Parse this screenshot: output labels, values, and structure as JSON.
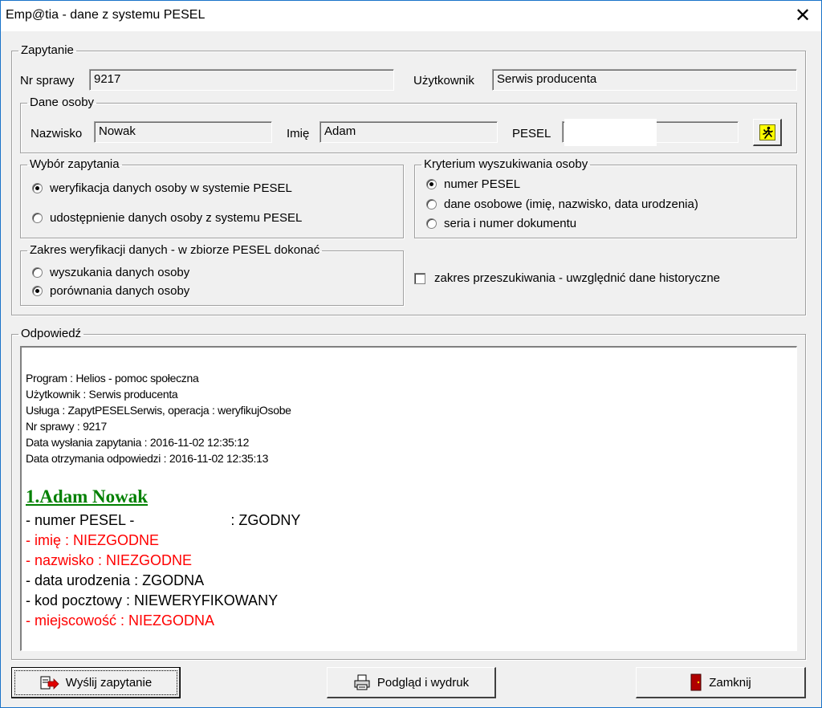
{
  "window": {
    "title": "Emp@tia - dane z systemu PESEL",
    "close_glyph": "✕"
  },
  "zapytanie": {
    "legend": "Zapytanie",
    "nr_sprawy_label": "Nr sprawy",
    "nr_sprawy_value": "9217",
    "uzytkownik_label": "Użytkownik",
    "uzytkownik_value": "Serwis producenta",
    "dane_osoby": {
      "legend": "Dane osoby",
      "nazwisko_label": "Nazwisko",
      "nazwisko_value": "Nowak",
      "imie_label": "Imię",
      "imie_value": "Adam",
      "pesel_label": "PESEL",
      "pesel_value": "",
      "search_button_icon": "running-man-icon"
    },
    "wybor": {
      "legend": "Wybór zapytania",
      "options": [
        {
          "label": "weryfikacja danych osoby w systemie PESEL",
          "checked": true
        },
        {
          "label": "udostępnienie danych osoby z systemu PESEL",
          "checked": false
        }
      ]
    },
    "kryterium": {
      "legend": "Kryterium wyszukiwania osoby",
      "options": [
        {
          "label": "numer PESEL",
          "checked": true
        },
        {
          "label": "dane osobowe (imię, nazwisko, data urodzenia)",
          "checked": false
        },
        {
          "label": "seria i numer dokumentu",
          "checked": false
        }
      ]
    },
    "zakres": {
      "legend": "Zakres weryfikacji danych - w zbiorze PESEL dokonać",
      "options": [
        {
          "label": "wyszukania danych osoby",
          "checked": false
        },
        {
          "label": "porównania danych osoby",
          "checked": true
        }
      ]
    },
    "historyczne_label": "zakres przeszukiwania - uwzględnić dane historyczne",
    "historyczne_checked": false
  },
  "odpowiedz": {
    "legend": "Odpowiedź",
    "meta": [
      "Program : Helios - pomoc społeczna",
      "Użytkownik : Serwis producenta",
      "Usługa : ZapytPESELSerwis, operacja : weryfikujOsobe",
      "Nr sprawy : 9217",
      "Data wysłania zapytania : 2016-11-02 12:35:12",
      "Data otrzymania odpowiedzi : 2016-11-02 12:35:13"
    ],
    "person": "1.Adam Nowak",
    "results": [
      {
        "text": "- numer PESEL -                        : ZGODNY",
        "status": "ok"
      },
      {
        "text": "- imię : NIEZGODNE",
        "status": "bad"
      },
      {
        "text": "- nazwisko : NIEZGODNE",
        "status": "bad"
      },
      {
        "text": "- data urodzenia : ZGODNA",
        "status": "ok"
      },
      {
        "text": "- kod pocztowy : NIEWERYFIKOWANY",
        "status": "ok"
      },
      {
        "text": "- miejscowość : NIEZGODNA",
        "status": "bad"
      }
    ]
  },
  "buttons": {
    "send": {
      "label": "Wyślij zapytanie",
      "icon": "send-arrow-icon"
    },
    "preview": {
      "label": "Podgląd i wydruk",
      "icon": "printer-icon"
    },
    "close": {
      "label": "Zamknij",
      "icon": "exit-door-icon"
    }
  },
  "colors": {
    "ok": "#000000",
    "bad": "#ff0000",
    "person": "#008000",
    "title_border": "#1a73c9"
  }
}
